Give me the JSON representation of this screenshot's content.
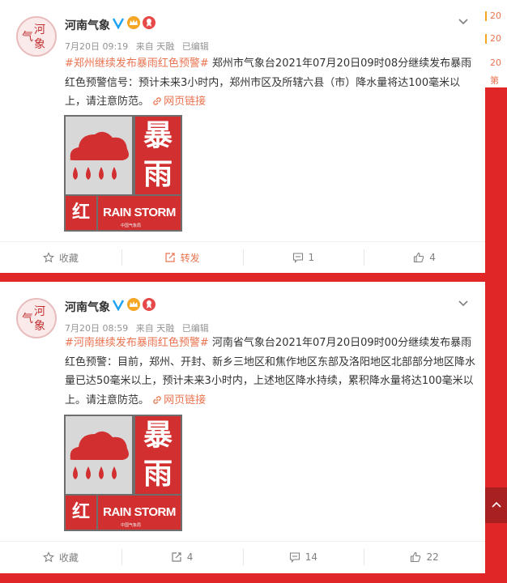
{
  "colors": {
    "page_bg": "#e02626",
    "card_bg": "#ffffff",
    "accent": "#eb7350",
    "meta_text": "#939393",
    "body_text": "#333333",
    "warning_red": "#d23030"
  },
  "icons": {
    "verified": "verified-v-icon",
    "crown": "crown-badge-icon",
    "ribbon": "ribbon-badge-icon",
    "menu": "chevron-down-icon",
    "link": "link-icon",
    "favorite": "star-icon",
    "repost": "repost-icon",
    "comment": "comment-icon",
    "like": "thumb-up-icon",
    "scroll_top": "arrow-up-icon"
  },
  "sidebar": {
    "items": [
      "20",
      "20",
      "20",
      "第"
    ]
  },
  "posts": [
    {
      "username": "河南气象",
      "avatar_text": [
        "气",
        "河",
        "象"
      ],
      "time": "7月20日 09:19",
      "source": "来自 天融",
      "edited": "已编辑",
      "hashtag": "#郑州继续发布暴雨红色预警#",
      "content": " 郑州市气象台2021年07月20日09时08分继续发布暴雨红色预警信号：预计未来3小时内，郑州市区及所辖六县（市）降水量将达100毫米以上，请注意防范。 ",
      "link_label": "网页链接",
      "warning_image": {
        "char_top": "暴",
        "char_bottom": "雨",
        "color_char": "红",
        "english": "RAIN STORM",
        "watermark": "中国气象局"
      },
      "actions": {
        "favorite": "收藏",
        "repost": "转发",
        "comment": "1",
        "like": "4"
      }
    },
    {
      "username": "河南气象",
      "avatar_text": [
        "气",
        "河",
        "象"
      ],
      "time": "7月20日 08:59",
      "source": "来自 天融",
      "edited": "已编辑",
      "hashtag": "#河南继续发布暴雨红色预警#",
      "content": " 河南省气象台2021年07月20日09时00分继续发布暴雨红色预警：目前，郑州、开封、新乡三地区和焦作地区东部及洛阳地区北部部分地区降水量已达50毫米以上，预计未来3小时内，上述地区降水持续，累积降水量将达100毫米以上。请注意防范。 ",
      "link_label": "网页链接",
      "warning_image": {
        "char_top": "暴",
        "char_bottom": "雨",
        "color_char": "红",
        "english": "RAIN STORM",
        "watermark": "中国气象局"
      },
      "actions": {
        "favorite": "收藏",
        "repost": "4",
        "comment": "14",
        "like": "22"
      }
    }
  ]
}
